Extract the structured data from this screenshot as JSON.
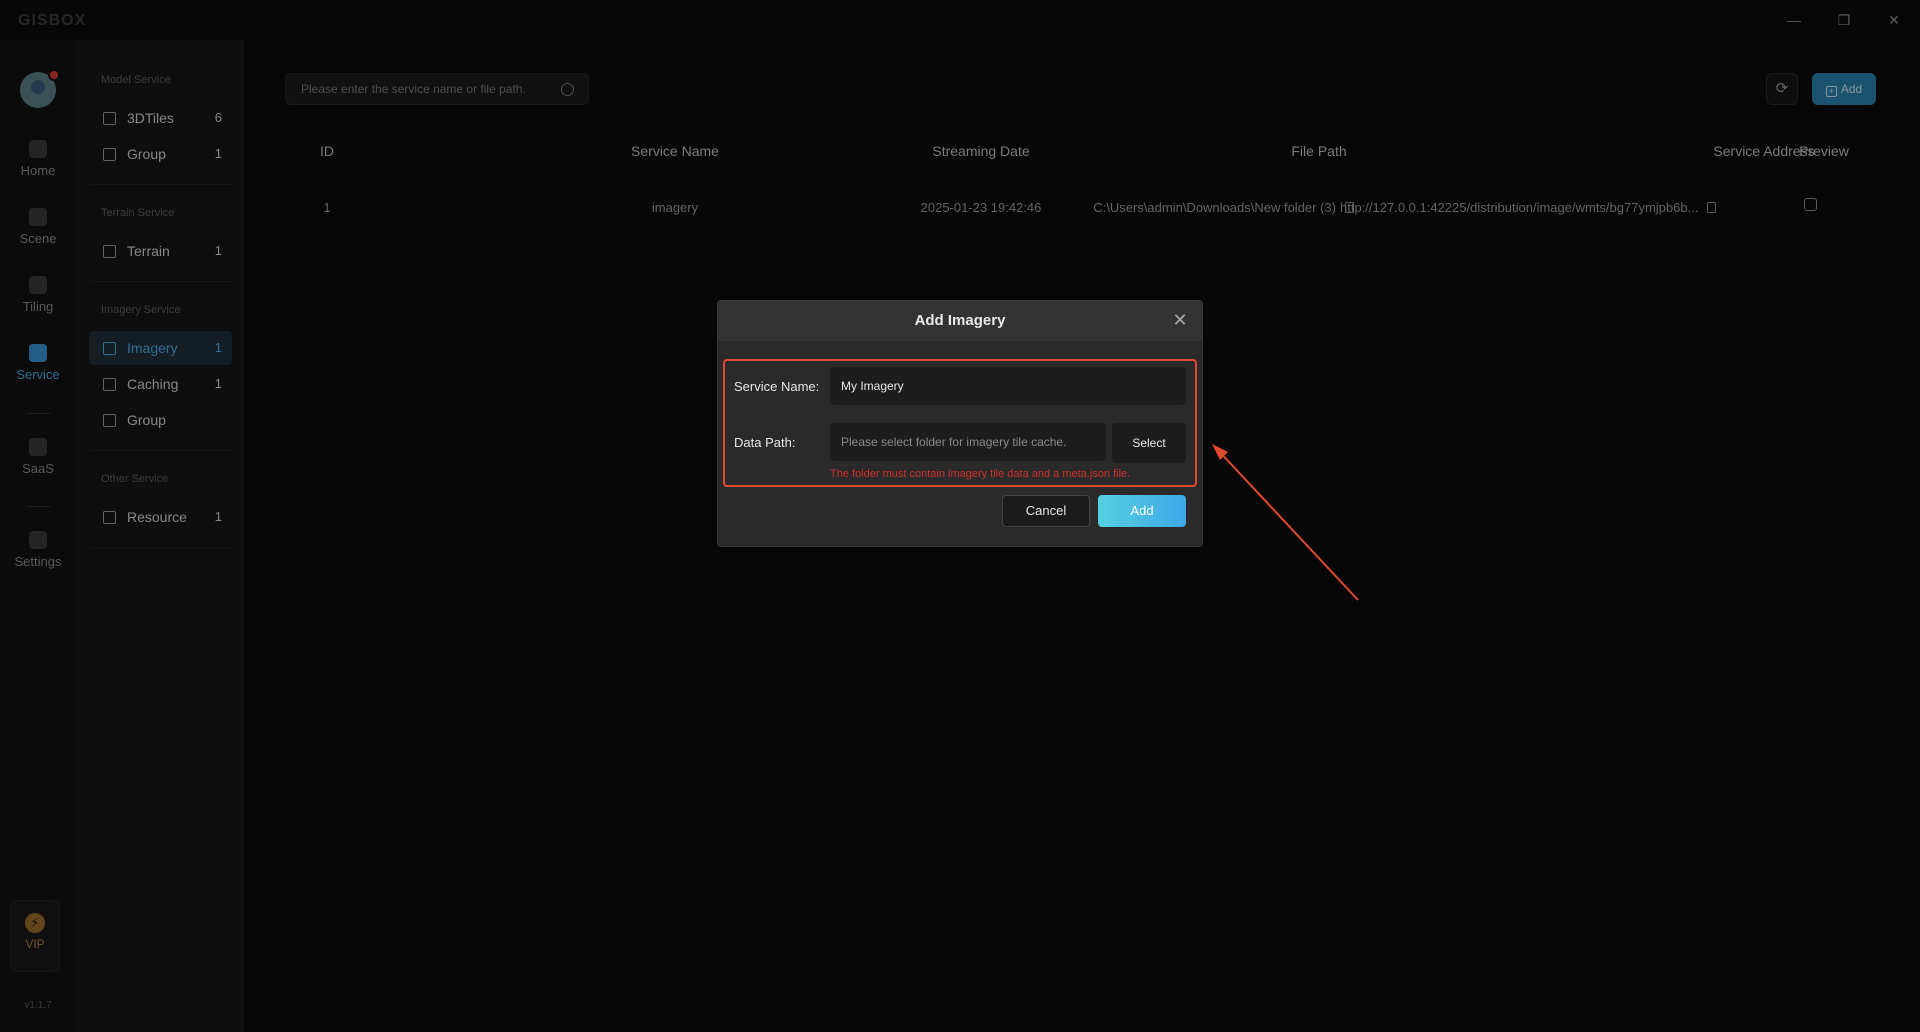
{
  "app": {
    "logo": "GISBOX",
    "window_controls": {
      "minimize": "—",
      "restore": "❐",
      "close": "✕"
    },
    "version": "v1.1.7"
  },
  "rail": {
    "items": [
      {
        "label": "Home",
        "icon": "home-icon"
      },
      {
        "label": "Scene",
        "icon": "cube-icon"
      },
      {
        "label": "Tiling",
        "icon": "tiling-icon"
      },
      {
        "label": "Service",
        "icon": "service-icon",
        "active": true
      },
      {
        "label": "SaaS",
        "icon": "lock-icon"
      },
      {
        "label": "Settings",
        "icon": "gear-icon"
      }
    ],
    "vip": {
      "label": "VIP",
      "glyph": "⚡"
    }
  },
  "menu": {
    "sections": [
      {
        "title": "Model Service",
        "items": [
          {
            "label": "3DTiles",
            "count": "6"
          },
          {
            "label": "Group",
            "count": "1"
          }
        ]
      },
      {
        "title": "Terrain Service",
        "items": [
          {
            "label": "Terrain",
            "count": "1"
          }
        ]
      },
      {
        "title": "Imagery Service",
        "items": [
          {
            "label": "Imagery",
            "count": "1",
            "active": true
          },
          {
            "label": "Caching",
            "count": "1"
          },
          {
            "label": "Group",
            "count": ""
          }
        ]
      },
      {
        "title": "Other Service",
        "items": [
          {
            "label": "Resource",
            "count": "1"
          }
        ]
      }
    ]
  },
  "toolbar": {
    "search_placeholder": "Please enter the service name or file path.",
    "refresh_glyph": "⟳",
    "add_label": "Add",
    "add_glyph": "+"
  },
  "table": {
    "headers": [
      "ID",
      "Service Name",
      "Streaming Date",
      "File Path",
      "Service Address",
      "Preview"
    ],
    "rows": [
      {
        "id": "1",
        "name": "imagery",
        "date": "2025-01-23 19:42:46",
        "path": "C:\\Users\\admin\\Downloads\\New folder (3)",
        "address": "http://127.0.0.1:42225/distribution/image/wmts/bg77ymjpb6b..."
      }
    ]
  },
  "modal": {
    "title": "Add Imagery",
    "close_glyph": "✕",
    "service_name_label": "Service Name:",
    "service_name_value": "My Imagery",
    "data_path_label": "Data Path:",
    "data_path_placeholder": "Please select folder for imagery tile cache.",
    "select_label": "Select",
    "error": "The folder must contain imagery tile data and a meta.json file.",
    "cancel_label": "Cancel",
    "add_label": "Add"
  },
  "colors": {
    "accent": "#4aa8e0",
    "highlight": "#e04a2f",
    "error": "#d0302a"
  }
}
